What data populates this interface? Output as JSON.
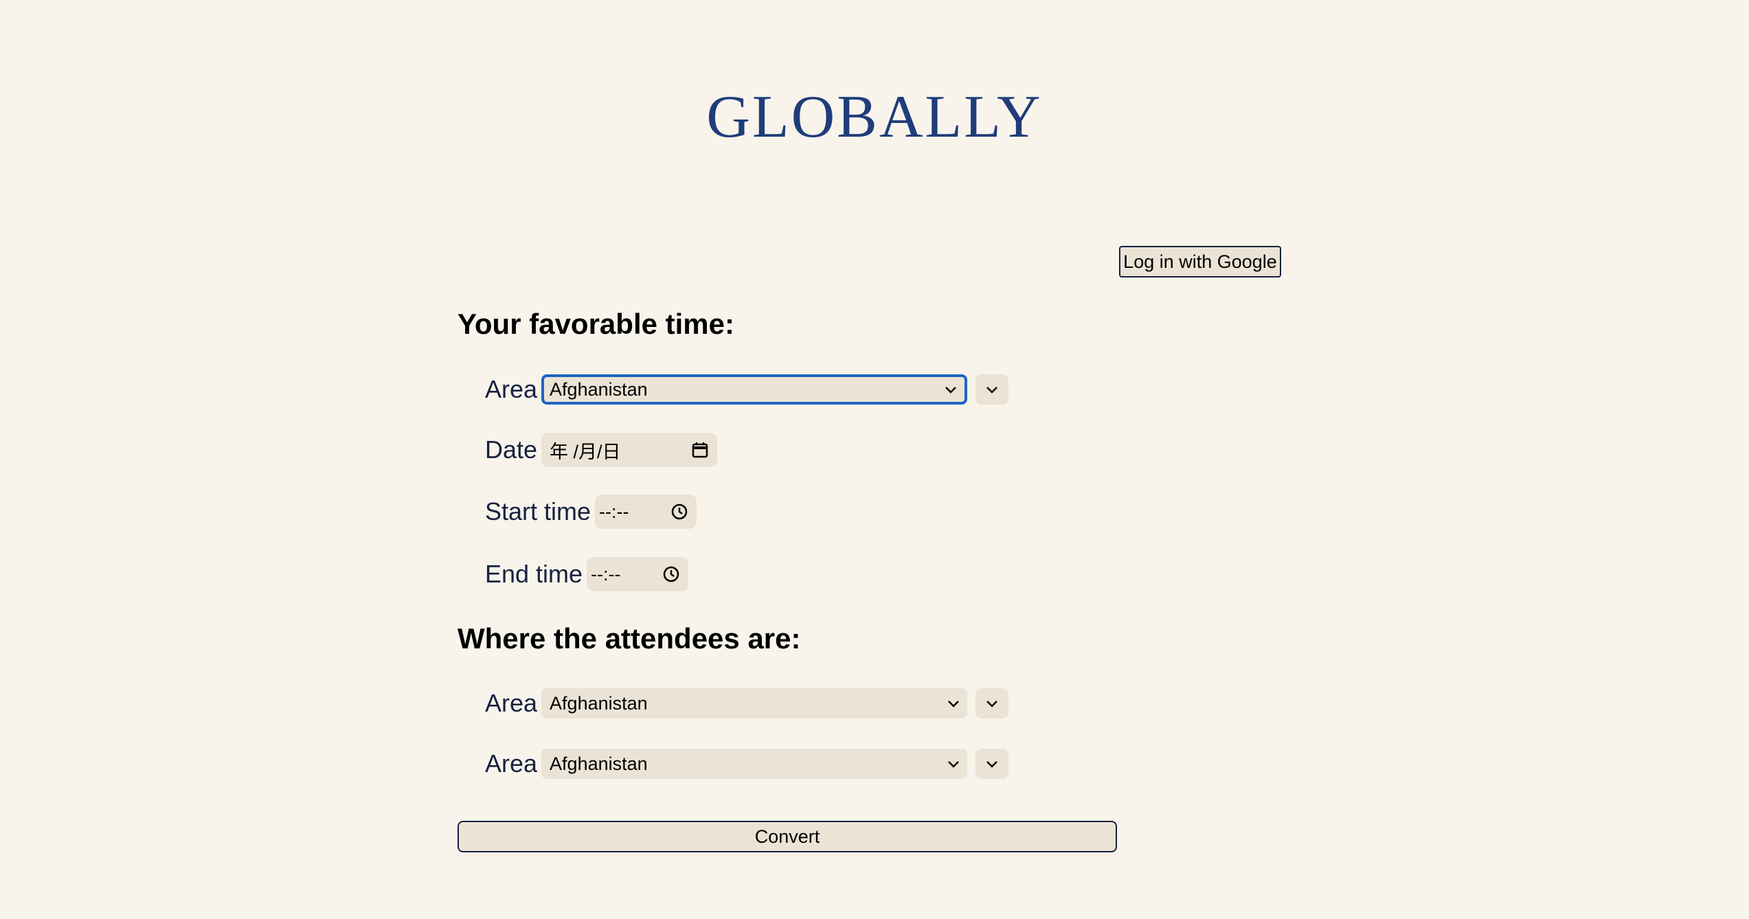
{
  "header": {
    "logo_text": "GLOBALLY"
  },
  "auth": {
    "login_label": "Log in with Google"
  },
  "favorable": {
    "title": "Your favorable time:",
    "area_label": "Area",
    "area_value": "Afghanistan",
    "date_label": "Date",
    "date_placeholder": "年 /月/日",
    "start_label": "Start time",
    "start_placeholder": "--:--",
    "end_label": "End time",
    "end_placeholder": "--:--"
  },
  "attendees": {
    "title": "Where the attendees are:",
    "rows": [
      {
        "area_label": "Area",
        "area_value": "Afghanistan"
      },
      {
        "area_label": "Area",
        "area_value": "Afghanistan"
      }
    ]
  },
  "actions": {
    "convert_label": "Convert"
  },
  "colors": {
    "background": "#f8f4ec",
    "logo": "#1f3d7a",
    "control_bg": "#ebe3d5",
    "focus_ring": "#1e63c4"
  }
}
